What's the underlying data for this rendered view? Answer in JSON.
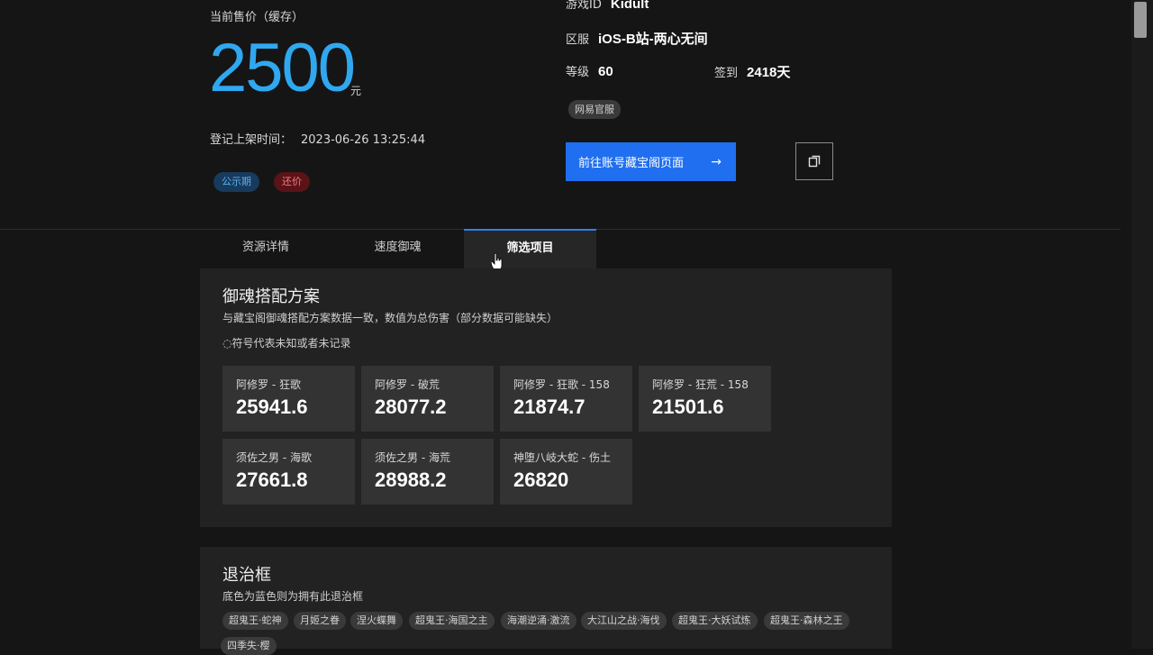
{
  "price": {
    "label": "当前售价（缓存）",
    "value": "2500",
    "unit": "元",
    "listed_label": "登记上架时间：",
    "listed_value": "2023-06-26 13:25:44",
    "badges": [
      "公示期",
      "还价"
    ]
  },
  "account": {
    "game_id_label": "游戏ID",
    "game_id": "Kidult",
    "server_label": "区服",
    "server": "iOS-B站-两心无间",
    "level_label": "等级",
    "level": "60",
    "signin_label": "签到",
    "signin": "2418天",
    "tag": "网易官服",
    "goto_button": "前往账号藏宝阁页面",
    "arrow": "→"
  },
  "tabs": [
    "资源详情",
    "速度御魂",
    "筛选项目"
  ],
  "active_tab": "筛选项目",
  "soul_section": {
    "title": "御魂搭配方案",
    "subtitle": "与藏宝阁御魂搭配方案数据一致，数值为总伤害（部分数据可能缺失）",
    "note": "◌符号代表未知或者未记录",
    "cards": [
      {
        "name": "阿修罗 - 狂歌",
        "value": "25941.6"
      },
      {
        "name": "阿修罗 - 破荒",
        "value": "28077.2"
      },
      {
        "name": "阿修罗 - 狂歌 - 158",
        "value": "21874.7"
      },
      {
        "name": "阿修罗 - 狂荒 - 158",
        "value": "21501.6"
      },
      {
        "name": "须佐之男 - 海歌",
        "value": "27661.8"
      },
      {
        "name": "须佐之男 - 海荒",
        "value": "28988.2"
      },
      {
        "name": "神堕八岐大蛇 - 伤土",
        "value": "26820"
      }
    ]
  },
  "frame_section": {
    "title": "退治框",
    "subtitle": "底色为蓝色则为拥有此退治框",
    "chips": [
      "超鬼王·蛇神",
      "月姬之眷",
      "涅火蝶舞",
      "超鬼王·海国之主",
      "海潮逆涌·激流",
      "大江山之战·海伐",
      "超鬼王·大妖试炼",
      "超鬼王·森林之王",
      "四季失·樱"
    ]
  }
}
